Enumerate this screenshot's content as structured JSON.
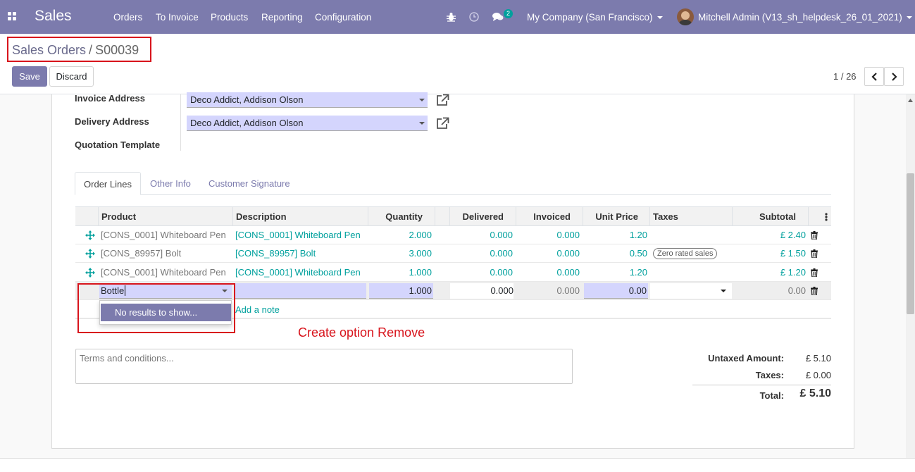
{
  "navbar": {
    "brand": "Sales",
    "menu": [
      "Orders",
      "To Invoice",
      "Products",
      "Reporting",
      "Configuration"
    ],
    "chat_count": "2",
    "company": "My Company (San Francisco)",
    "user": "Mitchell Admin (V13_sh_helpdesk_26_01_2021)",
    "icons": [
      "apps-icon",
      "bug-icon",
      "clock-icon",
      "chat-icon"
    ]
  },
  "breadcrumb": {
    "parent": "Sales Orders",
    "separator": "/",
    "current": "S00039"
  },
  "toolbar": {
    "save": "Save",
    "discard": "Discard"
  },
  "pager": {
    "value": "1 / 26"
  },
  "form": {
    "invoice_address_label": "Invoice Address",
    "invoice_address": "Deco Addict, Addison Olson",
    "delivery_address_label": "Delivery Address",
    "delivery_address": "Deco Addict, Addison Olson",
    "quotation_template_label": "Quotation Template"
  },
  "tabs": [
    "Order Lines",
    "Other Info",
    "Customer Signature"
  ],
  "table": {
    "headers": [
      "Product",
      "Description",
      "Quantity",
      "Delivered",
      "Invoiced",
      "Unit Price",
      "Taxes",
      "Subtotal"
    ],
    "rows": [
      {
        "product": "[CONS_0001] Whiteboard Pen",
        "description": "[CONS_0001] Whiteboard Pen",
        "quantity": "2.000",
        "delivered": "0.000",
        "invoiced": "0.000",
        "unit_price": "1.20",
        "taxes": "",
        "subtotal": "£ 2.40"
      },
      {
        "product": "[CONS_89957] Bolt",
        "description": "[CONS_89957] Bolt",
        "quantity": "3.000",
        "delivered": "0.000",
        "invoiced": "0.000",
        "unit_price": "0.50",
        "taxes": "Zero rated sales",
        "subtotal": "£ 1.50"
      },
      {
        "product": "[CONS_0001] Whiteboard Pen",
        "description": "[CONS_0001] Whiteboard Pen",
        "quantity": "1.000",
        "delivered": "0.000",
        "invoiced": "0.000",
        "unit_price": "1.20",
        "taxes": "",
        "subtotal": "£ 1.20"
      }
    ],
    "edit_row": {
      "product": "Bottle",
      "quantity": "1.000",
      "delivered": "0.000",
      "invoiced": "0.000",
      "unit_price": "0.00",
      "subtotal": "0.00"
    },
    "dropdown_item": "No results to show...",
    "add_note": "Add a note"
  },
  "annotation": "Create option Remove",
  "terms_placeholder": "Terms and conditions...",
  "totals": {
    "untaxed_label": "Untaxed Amount:",
    "untaxed": "£ 5.10",
    "taxes_label": "Taxes:",
    "taxes": "£ 0.00",
    "total_label": "Total:",
    "total": "£ 5.10"
  },
  "colors": {
    "primary": "#7c7bad",
    "teal": "#00a09d",
    "highlight": "#d8141c",
    "field": "#d4d5fd"
  }
}
